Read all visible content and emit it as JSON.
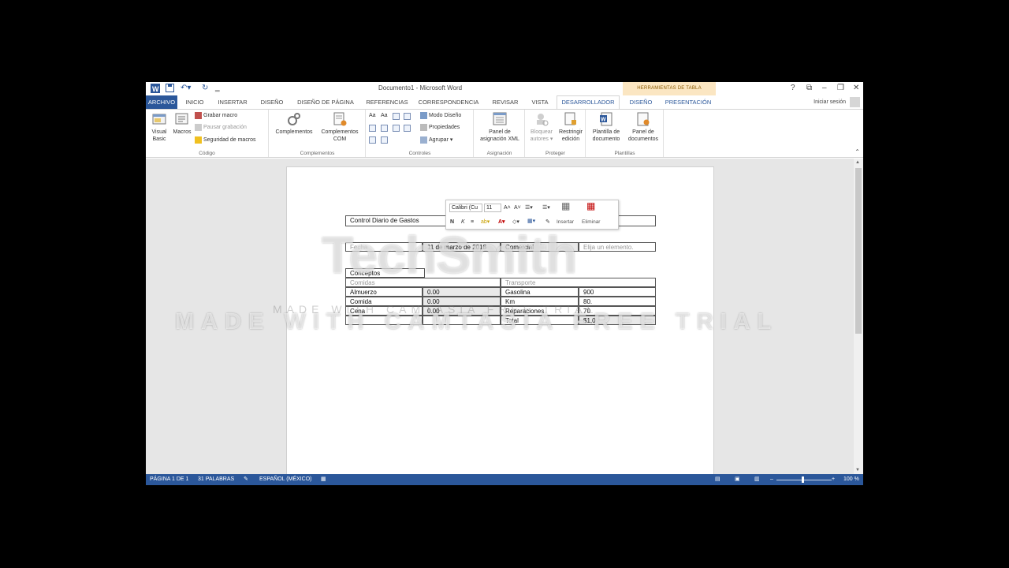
{
  "window": {
    "title": "Documento1 - Microsoft Word",
    "tools_header": "HERRAMIENTAS DE TABLA",
    "controls": [
      "?",
      "⧉",
      "–",
      "❐",
      "✕"
    ]
  },
  "tabs": {
    "file": "ARCHIVO",
    "items": [
      "INICIO",
      "INSERTAR",
      "DISEÑO",
      "DISEÑO DE PÁGINA",
      "REFERENCIAS",
      "CORRESPONDENCIA",
      "REVISAR",
      "VISTA",
      "DESARROLLADOR",
      "DISEÑO",
      "PRESENTACIÓN"
    ],
    "sign_in": "Iniciar sesión"
  },
  "ribbon": {
    "codigo": {
      "label": "Código",
      "visual_basic": "Visual Basic",
      "macros": "Macros",
      "grabar": "Grabar macro",
      "pausar": "Pausar grabación",
      "seguridad": "Seguridad de macros"
    },
    "complementos": {
      "label": "Complementos",
      "complementos": "Complementos",
      "com_1": "Complementos",
      "com_2": "COM"
    },
    "controles": {
      "label": "Controles",
      "modo_diseno": "Modo Diseño",
      "propiedades": "Propiedades",
      "agrupar": "Agrupar",
      "aa1": "Aa",
      "aa2": "Aa"
    },
    "asignacion": {
      "label": "Asignación",
      "panel_1": "Panel de",
      "panel_2": "asignación XML"
    },
    "proteger": {
      "label": "Proteger",
      "bloquear_1": "Bloquear",
      "bloquear_2": "autores",
      "restringir_1": "Restringir",
      "restringir_2": "edición"
    },
    "plantillas": {
      "label": "Plantillas",
      "plantilla_1": "Plantilla de",
      "plantilla_2": "documento",
      "panel_1": "Panel de",
      "panel_2": "documentos"
    }
  },
  "document": {
    "title": "Control Diario de Gastos",
    "row_fecha": [
      "Fecha",
      "11 de marzo de 2018",
      "Comercial",
      "Elija un elemento."
    ],
    "conceptos": "Conceptos",
    "subheaders": [
      "Comidas",
      "Transporte"
    ],
    "rows": [
      [
        "Almuerzo",
        "0.00",
        "Gasolina",
        "900"
      ],
      [
        "Comida",
        "0.00",
        "Km",
        "80."
      ],
      [
        "Cena",
        "0.00",
        "Reparaciones",
        "70"
      ],
      [
        "",
        "",
        "Total",
        "$1,0"
      ]
    ]
  },
  "mini_toolbar": {
    "font": "Calibri (Cu",
    "size": "11",
    "bold": "N",
    "italic": "K",
    "insertar": "Insertar",
    "eliminar": "Eliminar"
  },
  "watermark": {
    "brand": "TechSmith",
    "line": "MADE WITH CAMTASIA FREE TRIAL",
    "line_faint": "MADE WITH CAMTASIA FREE TRIAL"
  },
  "status": {
    "page": "PÁGINA 1 DE 1",
    "words": "31 PALABRAS",
    "language": "ESPAÑOL (MÉXICO)",
    "zoom": "100 %",
    "zoom_percent": 100
  },
  "colors": {
    "brand_blue": "#2b579a",
    "tools_tab": "#fbe6c2"
  }
}
